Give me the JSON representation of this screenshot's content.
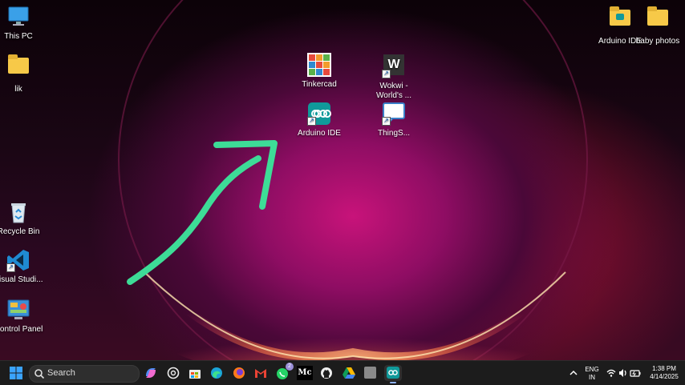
{
  "desktop": {
    "left_icons": [
      {
        "label": "This PC"
      },
      {
        "label": "lik"
      },
      {
        "label": "Recycle Bin"
      },
      {
        "label": "Visual Studi..."
      },
      {
        "label": "Control Panel"
      }
    ],
    "center_icons": [
      {
        "label": "Tinkercad"
      },
      {
        "label": "Wokwi - World's ..."
      },
      {
        "label": "Arduino IDE"
      },
      {
        "label": "ThingS..."
      }
    ],
    "right_icons": [
      {
        "label": "Arduino IDE"
      },
      {
        "label": "baby photos"
      }
    ],
    "annotation_arrow_color": "#3ddc97"
  },
  "taskbar": {
    "search_label": "Search",
    "whatsapp_badge": "2",
    "medium_label": "Mc",
    "wokwi_tile_letter": "W",
    "language_line1": "ENG",
    "language_line2": "IN",
    "time": "1:38 PM",
    "date": "4/14/2025"
  }
}
